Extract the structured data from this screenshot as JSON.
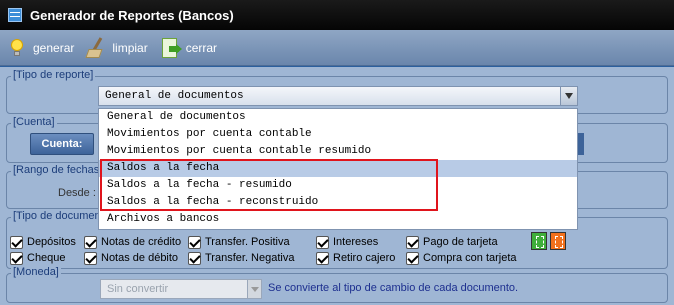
{
  "window": {
    "title": "Generador de Reportes (Bancos)"
  },
  "toolbar": {
    "generar_label": "generar",
    "limpiar_label": "limpiar",
    "cerrar_label": "cerrar"
  },
  "tipo_reporte": {
    "legend": "[Tipo de reporte]",
    "selected": "General de documentos",
    "options": [
      "General de documentos",
      "Movimientos por cuenta contable",
      "Movimientos por cuenta contable resumido",
      "Saldos a la fecha",
      "Saldos a la fecha - resumido",
      "Saldos a la fecha - reconstruido",
      "Archivos a bancos"
    ],
    "highlighted_index": 3
  },
  "cuenta": {
    "legend": "[Cuenta]",
    "button_label": "Cuenta:"
  },
  "rango": {
    "legend": "[Rango de fechas",
    "desde_label": "Desde :"
  },
  "tipo_documento": {
    "legend": "[Tipo de documen",
    "checks": [
      "Depósitos",
      "Notas de crédito",
      "Transfer. Positiva",
      "Intereses",
      "Pago de tarjeta",
      "Cheque",
      "Notas de débito",
      "Transfer. Negativa",
      "Retiro cajero",
      "Compra con tarjeta"
    ]
  },
  "moneda": {
    "legend": "[Moneda]",
    "selected": "Sin convertir",
    "note": "Se convierte al tipo de cambio de cada documento."
  },
  "colors": {
    "highlight": "#e0141c",
    "selected_row": "#b8cbe6",
    "toolbar": "#7a94b8"
  }
}
